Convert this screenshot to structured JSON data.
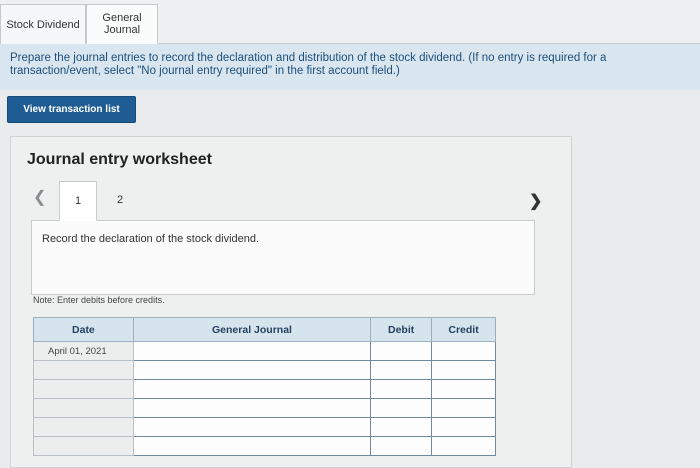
{
  "tabs": [
    {
      "label": "Stock Dividend"
    },
    {
      "label": "General Journal"
    }
  ],
  "instruction": "Prepare the journal entries to record the declaration and distribution of the stock dividend. (If no entry is required for a transaction/event, select \"No journal entry required\" in the first account field.)",
  "view_transaction_button": "View transaction list",
  "worksheet": {
    "title": "Journal entry worksheet",
    "prev_icon": "chevron-left-icon",
    "next_icon": "chevron-right-icon",
    "pages": [
      "1",
      "2"
    ],
    "entry_description": "Record the declaration of the stock dividend.",
    "note": "Note: Enter debits before credits."
  },
  "journal_table": {
    "headers": [
      "Date",
      "General Journal",
      "Debit",
      "Credit"
    ],
    "rows": [
      {
        "date": "April 01, 2021"
      },
      {
        "date": ""
      },
      {
        "date": ""
      },
      {
        "date": ""
      },
      {
        "date": ""
      },
      {
        "date": ""
      }
    ]
  },
  "colors": {
    "button_bg": "#1e5c93",
    "instruction_bg": "#d9e6ef",
    "table_header_bg": "#d6e4ee"
  }
}
